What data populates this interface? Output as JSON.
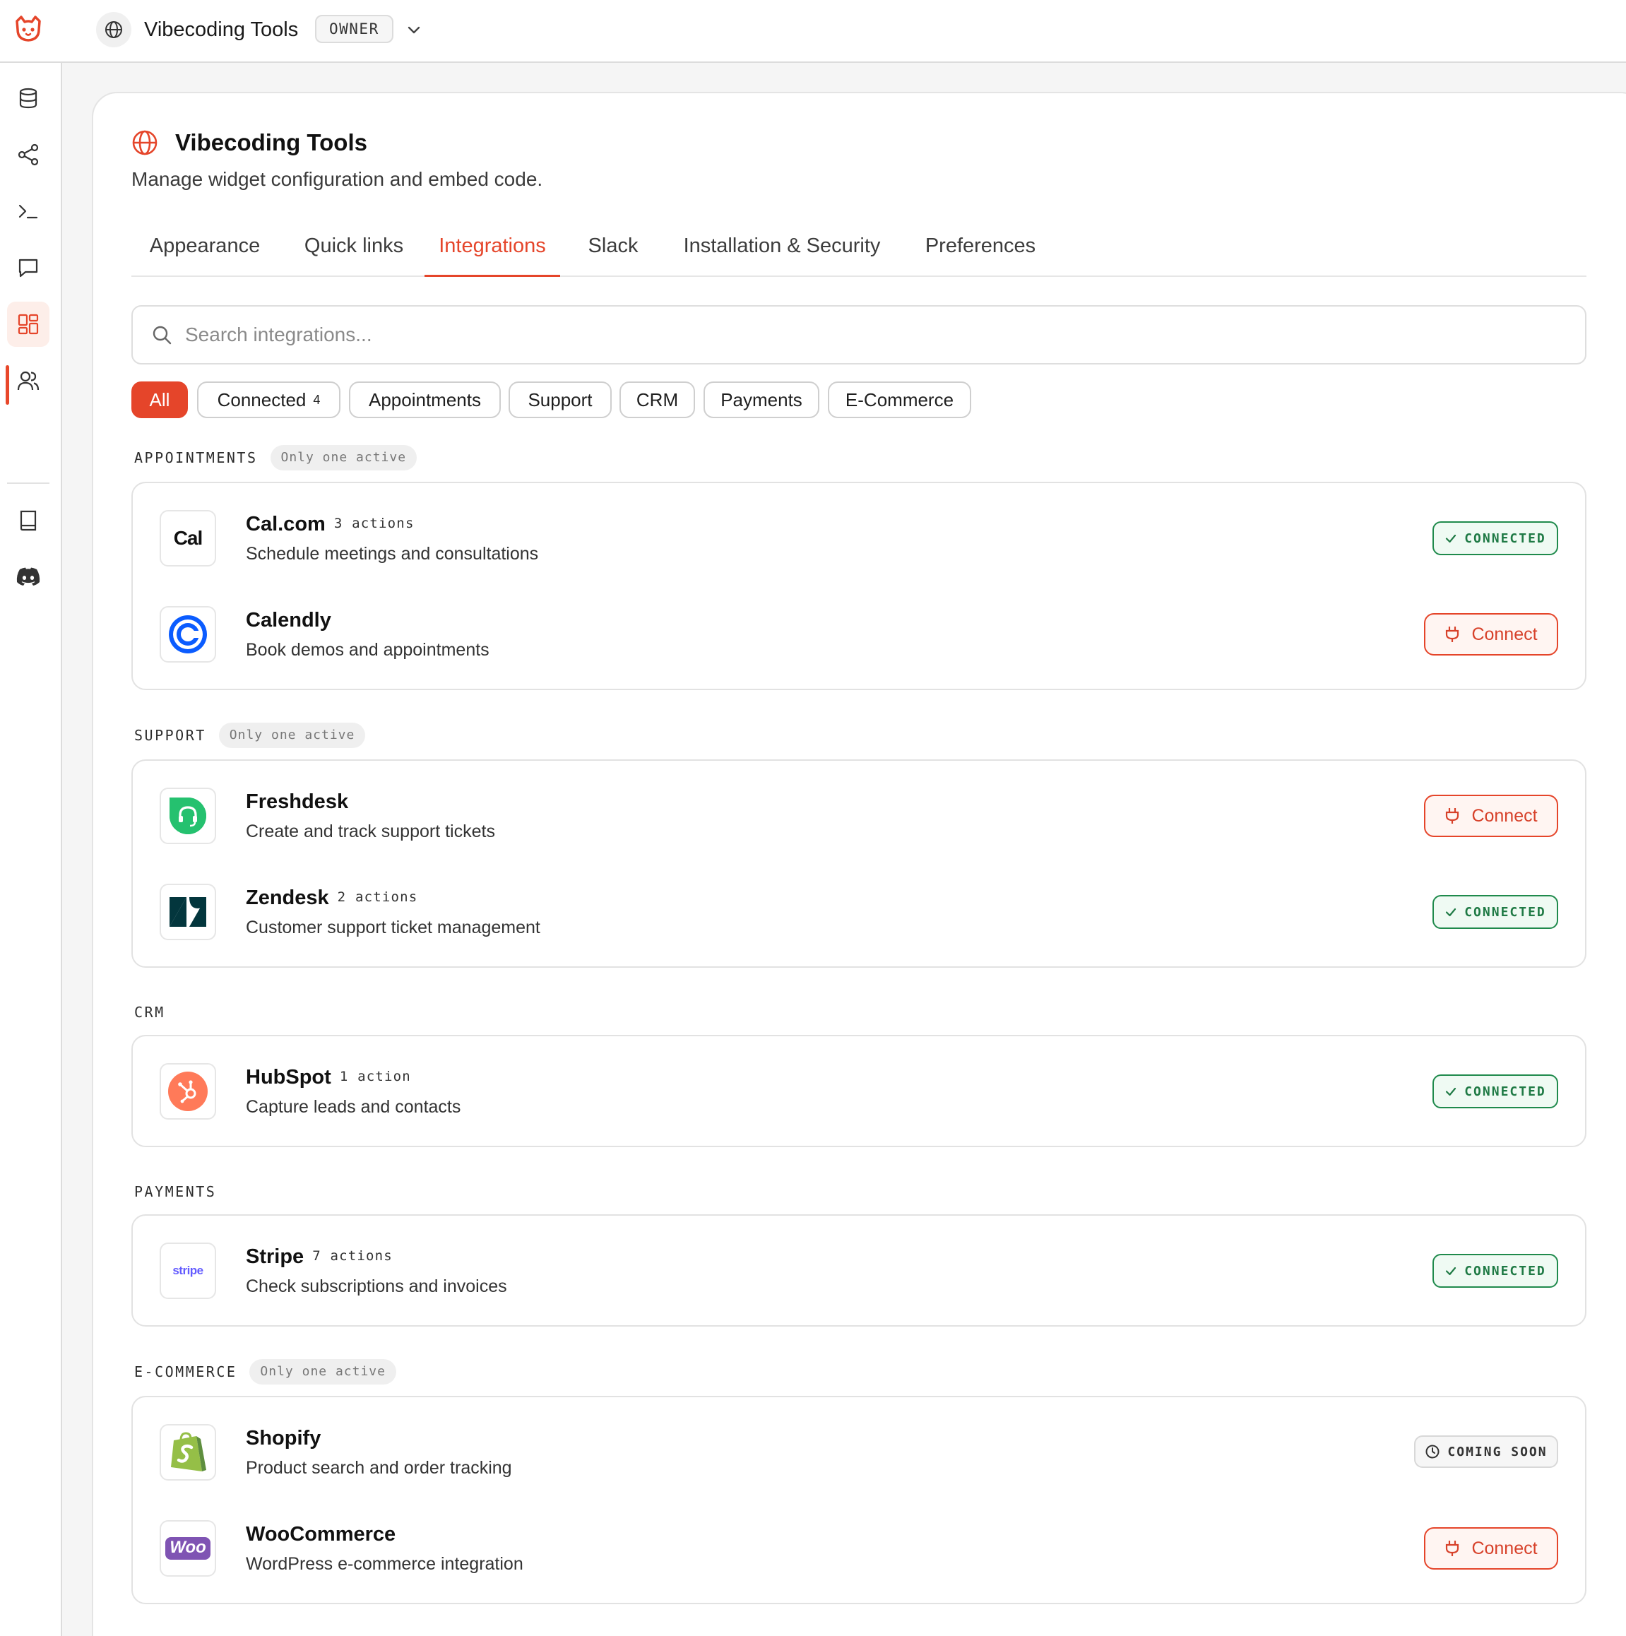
{
  "topbar": {
    "workspace_name": "Vibecoding Tools",
    "role_badge": "OWNER"
  },
  "sidebar": {
    "items": [
      {
        "icon": "database-icon"
      },
      {
        "icon": "share-nodes-icon"
      },
      {
        "icon": "terminal-icon"
      },
      {
        "icon": "chat-icon"
      },
      {
        "icon": "widgets-grid-icon",
        "active": true
      },
      {
        "icon": "users-icon"
      },
      {
        "icon": "book-icon"
      },
      {
        "icon": "discord-icon"
      }
    ]
  },
  "page": {
    "title": "Vibecoding Tools",
    "subtitle": "Manage widget configuration and embed code."
  },
  "tabs": [
    {
      "label": "Appearance"
    },
    {
      "label": "Quick links"
    },
    {
      "label": "Integrations",
      "active": true
    },
    {
      "label": "Slack"
    },
    {
      "label": "Installation & Security"
    },
    {
      "label": "Preferences"
    }
  ],
  "search": {
    "placeholder": "Search integrations..."
  },
  "filters": [
    {
      "label": "All",
      "active": true
    },
    {
      "label": "Connected",
      "count": "4"
    },
    {
      "label": "Appointments"
    },
    {
      "label": "Support"
    },
    {
      "label": "CRM"
    },
    {
      "label": "Payments"
    },
    {
      "label": "E-Commerce"
    }
  ],
  "labels": {
    "only_one_active": "Only one active",
    "connected": "CONNECTED",
    "connect": "Connect",
    "coming_soon": "COMING SOON"
  },
  "colors": {
    "accent": "#e5452a",
    "connected_green": "#1f8a4c"
  },
  "sections": [
    {
      "label": "APPOINTMENTS",
      "only_one_active": true,
      "items": [
        {
          "name": "Cal.com",
          "actions": "3 actions",
          "description": "Schedule meetings and consultations",
          "status": "connected",
          "icon": "calcom-logo"
        },
        {
          "name": "Calendly",
          "actions": "",
          "description": "Book demos and appointments",
          "status": "connect",
          "icon": "calendly-logo"
        }
      ]
    },
    {
      "label": "SUPPORT",
      "only_one_active": true,
      "items": [
        {
          "name": "Freshdesk",
          "actions": "",
          "description": "Create and track support tickets",
          "status": "connect",
          "icon": "freshdesk-logo"
        },
        {
          "name": "Zendesk",
          "actions": "2 actions",
          "description": "Customer support ticket management",
          "status": "connected",
          "icon": "zendesk-logo"
        }
      ]
    },
    {
      "label": "CRM",
      "only_one_active": false,
      "items": [
        {
          "name": "HubSpot",
          "actions": "1 action",
          "description": "Capture leads and contacts",
          "status": "connected",
          "icon": "hubspot-logo"
        }
      ]
    },
    {
      "label": "PAYMENTS",
      "only_one_active": false,
      "items": [
        {
          "name": "Stripe",
          "actions": "7 actions",
          "description": "Check subscriptions and invoices",
          "status": "connected",
          "icon": "stripe-logo",
          "logo_text": "stripe"
        }
      ]
    },
    {
      "label": "E-COMMERCE",
      "only_one_active": true,
      "items": [
        {
          "name": "Shopify",
          "actions": "",
          "description": "Product search and order tracking",
          "status": "coming_soon",
          "icon": "shopify-logo"
        },
        {
          "name": "WooCommerce",
          "actions": "",
          "description": "WordPress e-commerce integration",
          "status": "connect",
          "icon": "woocommerce-logo",
          "logo_text": "Woo"
        }
      ]
    }
  ]
}
